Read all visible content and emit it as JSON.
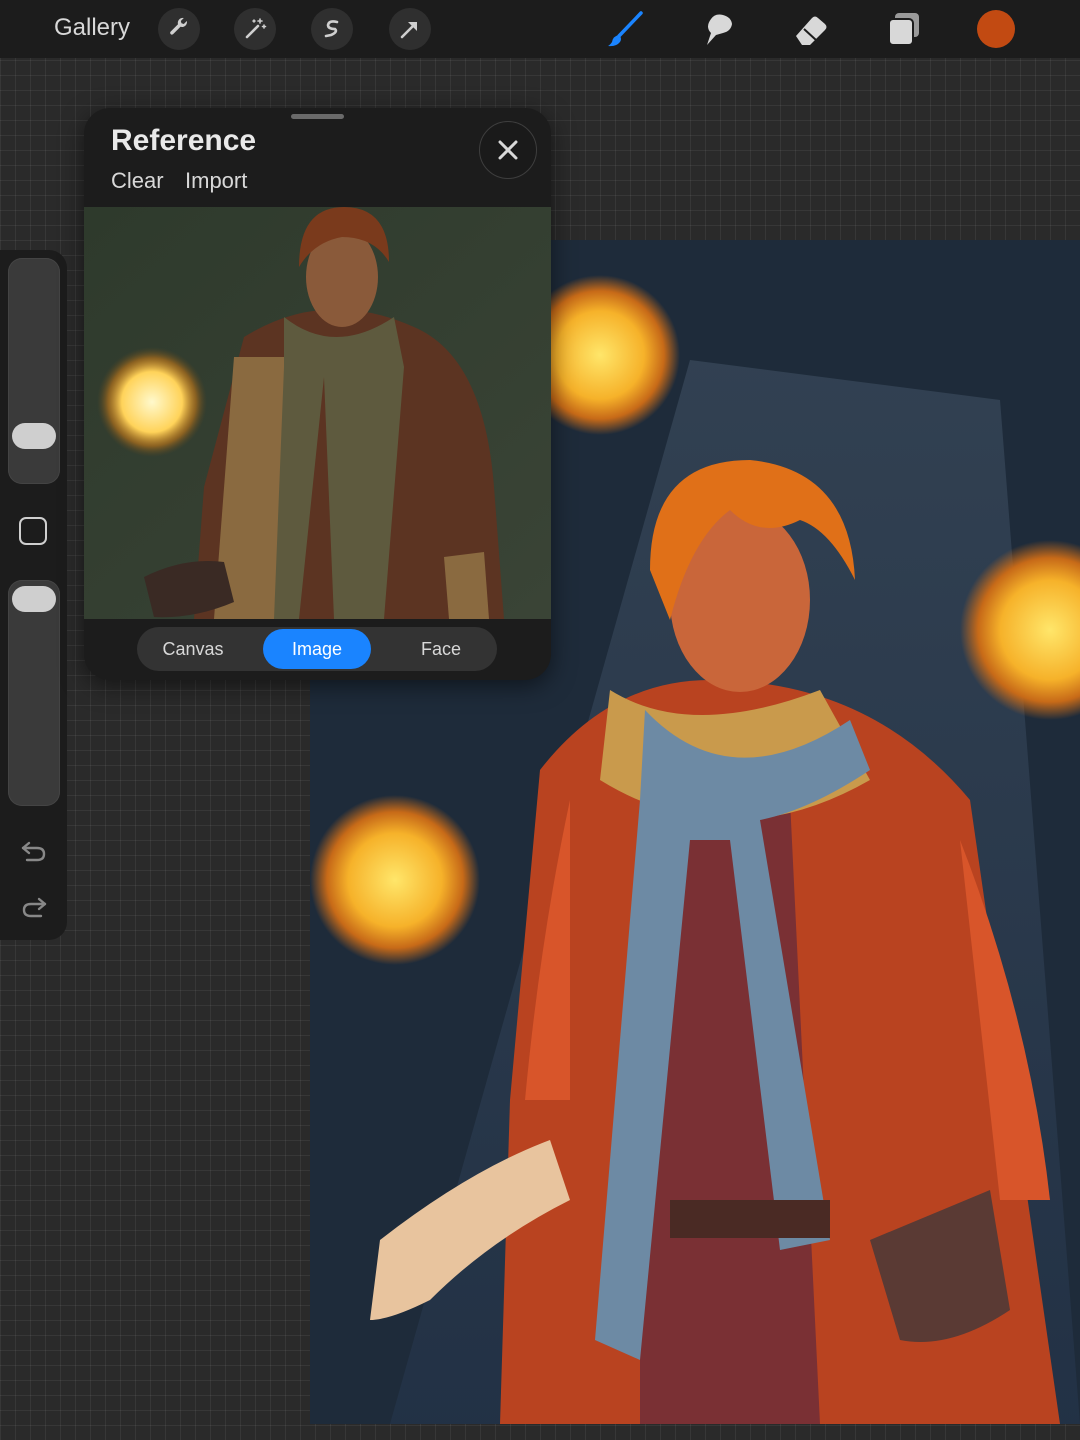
{
  "toolbar": {
    "gallery_label": "Gallery",
    "left_tools": [
      "wrench-icon",
      "magic-wand-icon",
      "selection-icon",
      "transform-arrow-icon"
    ],
    "paint_tools": [
      "brush-icon",
      "smudge-icon",
      "eraser-icon",
      "layers-icon"
    ],
    "active_tool": "brush-icon",
    "accent_color": "#1a84ff",
    "current_color": "#c24a12"
  },
  "sidebar": {
    "brush_size": 0.2,
    "opacity": 0.95,
    "controls": [
      "brush-size-slider",
      "modify-button",
      "opacity-slider",
      "undo-icon",
      "redo-icon"
    ]
  },
  "reference": {
    "title": "Reference",
    "clear_label": "Clear",
    "import_label": "Import",
    "tabs": [
      {
        "label": "Canvas",
        "active": false
      },
      {
        "label": "Image",
        "active": true
      },
      {
        "label": "Face",
        "active": false
      }
    ]
  }
}
